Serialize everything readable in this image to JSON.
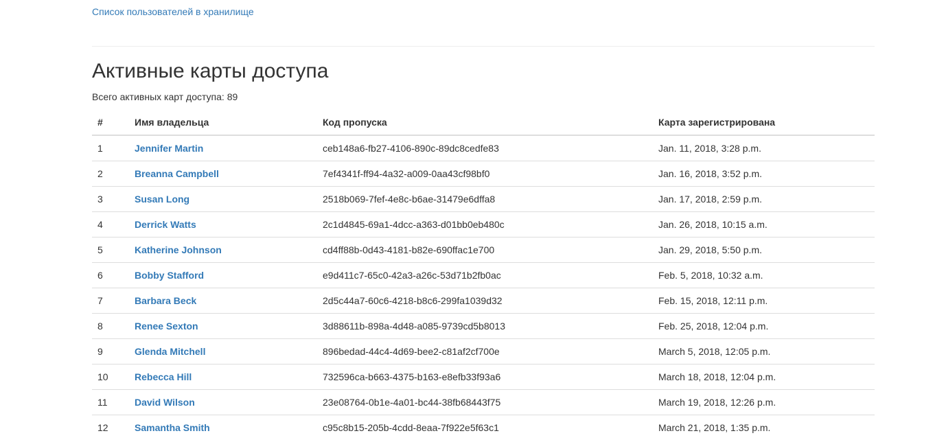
{
  "nav": {
    "users_link": "Список пользователей в хранилище"
  },
  "page": {
    "title": "Активные карты доступа",
    "total_label": "Всего активных карт доступа:",
    "total_count": "89"
  },
  "table": {
    "headers": {
      "num": "#",
      "owner": "Имя владельца",
      "code": "Код пропуска",
      "registered": "Карта зарегистрирована"
    },
    "rows": [
      {
        "num": "1",
        "owner": "Jennifer Martin",
        "code": "ceb148a6-fb27-4106-890c-89dc8cedfe83",
        "registered": "Jan. 11, 2018, 3:28 p.m."
      },
      {
        "num": "2",
        "owner": "Breanna Campbell",
        "code": "7ef4341f-ff94-4a32-a009-0aa43cf98bf0",
        "registered": "Jan. 16, 2018, 3:52 p.m."
      },
      {
        "num": "3",
        "owner": "Susan Long",
        "code": "2518b069-7fef-4e8c-b6ae-31479e6dffa8",
        "registered": "Jan. 17, 2018, 2:59 p.m."
      },
      {
        "num": "4",
        "owner": "Derrick Watts",
        "code": "2c1d4845-69a1-4dcc-a363-d01bb0eb480c",
        "registered": "Jan. 26, 2018, 10:15 a.m."
      },
      {
        "num": "5",
        "owner": "Katherine Johnson",
        "code": "cd4ff88b-0d43-4181-b82e-690ffac1e700",
        "registered": "Jan. 29, 2018, 5:50 p.m."
      },
      {
        "num": "6",
        "owner": "Bobby Stafford",
        "code": "e9d411c7-65c0-42a3-a26c-53d71b2fb0ac",
        "registered": "Feb. 5, 2018, 10:32 a.m."
      },
      {
        "num": "7",
        "owner": "Barbara Beck",
        "code": "2d5c44a7-60c6-4218-b8c6-299fa1039d32",
        "registered": "Feb. 15, 2018, 12:11 p.m."
      },
      {
        "num": "8",
        "owner": "Renee Sexton",
        "code": "3d88611b-898a-4d48-a085-9739cd5b8013",
        "registered": "Feb. 25, 2018, 12:04 p.m."
      },
      {
        "num": "9",
        "owner": "Glenda Mitchell",
        "code": "896bedad-44c4-4d69-bee2-c81af2cf700e",
        "registered": "March 5, 2018, 12:05 p.m."
      },
      {
        "num": "10",
        "owner": "Rebecca Hill",
        "code": "732596ca-b663-4375-b163-e8efb33f93a6",
        "registered": "March 18, 2018, 12:04 p.m."
      },
      {
        "num": "11",
        "owner": "David Wilson",
        "code": "23e08764-0b1e-4a01-bc44-38fb68443f75",
        "registered": "March 19, 2018, 12:26 p.m."
      },
      {
        "num": "12",
        "owner": "Samantha Smith",
        "code": "c95c8b15-205b-4cdd-8eaa-7f922e5f63c1",
        "registered": "March 21, 2018, 1:35 p.m."
      }
    ]
  },
  "colors": {
    "link": "#337ab7",
    "text": "#333333",
    "border": "#dddddd"
  }
}
